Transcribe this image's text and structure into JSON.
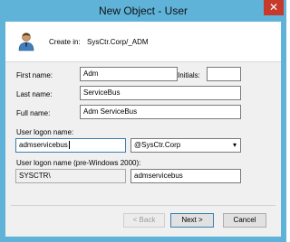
{
  "window": {
    "title": "New Object - User",
    "close_glyph": "✕"
  },
  "header": {
    "create_in_label": "Create in:",
    "create_in_path": "SysCtr.Corp/_ADM",
    "icon": "user-icon"
  },
  "form": {
    "first_name_label": "First name:",
    "first_name_value": "Adm",
    "initials_label": "Initials:",
    "initials_value": "",
    "last_name_label": "Last name:",
    "last_name_value": "ServiceBus",
    "full_name_label": "Full name:",
    "full_name_value": "Adm ServiceBus",
    "logon_name_label": "User logon name:",
    "logon_name_value": "admservicebus",
    "domain_value": "@SysCtr.Corp",
    "pre2000_label": "User logon name (pre-Windows 2000):",
    "pre2000_domain_value": "SYSCTR\\",
    "pre2000_name_value": "admservicebus"
  },
  "buttons": {
    "back": "< Back",
    "next": "Next >",
    "cancel": "Cancel"
  },
  "colors": {
    "titlebar": "#5fb3d9",
    "close": "#c7392a",
    "client": "#f0f0f0"
  }
}
